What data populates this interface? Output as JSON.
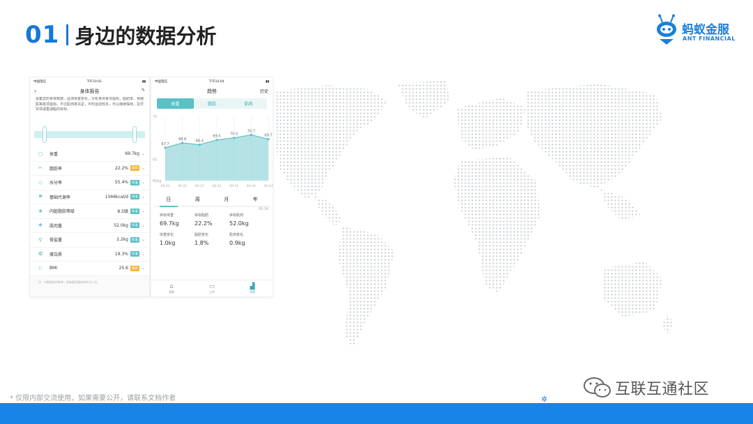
{
  "header": {
    "number": "01",
    "title": "身边的数据分析"
  },
  "logo": {
    "name": "蚂蚁金服",
    "sub": "ANT FINANCIAL"
  },
  "phone_left": {
    "status": {
      "carrier": "中国电信",
      "time": "下午10:01"
    },
    "nav_title": "身体报告",
    "intro": "采集您的身体数据，监测体重变化，分析身体各项指标，脂肪率、骨骼肌等各项指标。不过肌肉率充足，平时运动较多，可以继续保持，及早实现减重减脂的目标。",
    "metrics": [
      {
        "icon": "weight-icon",
        "glyph": "▢",
        "label": "体重",
        "value": "69.7kg",
        "badge": "",
        "badge_color": ""
      },
      {
        "icon": "body-fat-icon",
        "glyph": "✂",
        "label": "脂肪率",
        "value": "22.2%",
        "badge": "偏高",
        "badge_color": "#f5b335"
      },
      {
        "icon": "water-icon",
        "glyph": "◇",
        "label": "水分率",
        "value": "55.4%",
        "badge": "标准",
        "badge_color": "#5bc1c5"
      },
      {
        "icon": "metabolism-icon",
        "glyph": "⚑",
        "label": "基础代谢率",
        "value": "1566kcal/d",
        "badge": "标准",
        "badge_color": "#5bc1c5"
      },
      {
        "icon": "visceral-fat-icon",
        "glyph": "❀",
        "label": "内脏脂肪等级",
        "value": "8.5级",
        "badge": "标准",
        "badge_color": "#5bc1c5"
      },
      {
        "icon": "muscle-icon",
        "glyph": "❖",
        "label": "肌肉量",
        "value": "52.0kg",
        "badge": "标准",
        "badge_color": "#5bc1c5"
      },
      {
        "icon": "bone-icon",
        "glyph": "⚲",
        "label": "骨盐量",
        "value": "2.2kg",
        "badge": "标准",
        "badge_color": "#5bc1c5"
      },
      {
        "icon": "protein-icon",
        "glyph": "❂",
        "label": "蛋白质",
        "value": "19.3%",
        "badge": "标准",
        "badge_color": "#5bc1c5"
      },
      {
        "icon": "bmi-icon",
        "glyph": "⚐",
        "label": "BMI",
        "value": "25.6",
        "badge": "偏高",
        "badge_color": "#f5b335"
      }
    ],
    "footnote": "注：本数据仅供参考，如有疑问请咨询专业人员。"
  },
  "phone_right": {
    "status": {
      "carrier": "中国电信",
      "time": "下午10:04"
    },
    "nav_title": "趋势",
    "nav_right": "历史",
    "tabs": [
      "体重",
      "脂肪",
      "肌肉"
    ],
    "period_tabs": [
      "日",
      "周",
      "月",
      "年"
    ],
    "date": "06-24",
    "stats": [
      {
        "label": "目标体重",
        "value": "69.7kg"
      },
      {
        "label": "目标脂肪",
        "value": "22.2%"
      },
      {
        "label": "目标肌肉",
        "value": "52.0kg"
      },
      {
        "label": "体重变化",
        "value": "1.0kg"
      },
      {
        "label": "脂肪变化",
        "value": "1.8%"
      },
      {
        "label": "肌肉变化",
        "value": "0.9kg"
      }
    ],
    "tabbar": [
      "测量",
      "上传",
      "目标"
    ]
  },
  "chart_data": {
    "type": "area",
    "x": [
      "06-21",
      "06-22",
      "06-27",
      "06-31",
      "06-01",
      "06-04",
      "06-24"
    ],
    "values": [
      67.7,
      68.8,
      68.4,
      69.5,
      70.0,
      70.7,
      69.7
    ],
    "ylim": [
      60,
      75
    ],
    "yticks": [
      "75",
      "65",
      "60kg"
    ],
    "series_color": "#5bc1c5"
  },
  "footer": {
    "disclaimer": "* 仅限内部交流使用，如果需要公开，请联系文档作者",
    "community": "互联互通社区"
  }
}
